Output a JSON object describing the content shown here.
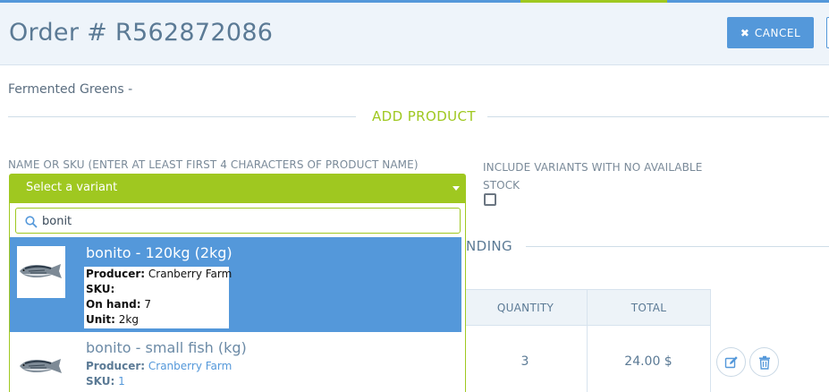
{
  "header": {
    "title": "Order # R562872086",
    "cancel_label": "CANCEL"
  },
  "subtitle": "Fermented Greens -",
  "add_product": {
    "section_title": "ADD PRODUCT",
    "name_label": "NAME OR SKU (ENTER AT LEAST FIRST 4 CHARACTERS OF PRODUCT NAME)",
    "select_placeholder": "Select a variant",
    "search_value": "bonit",
    "include_variants_label": "INCLUDE VARIANTS WITH NO AVAILABLE STOCK",
    "include_variants_checked": false
  },
  "results": [
    {
      "title": "bonito - 120kg (2kg)",
      "producer_label": "Producer:",
      "producer": "Cranberry Farm",
      "sku_label": "SKU:",
      "sku": "",
      "on_hand_label": "On hand:",
      "on_hand": "7",
      "unit_label": "Unit:",
      "unit": "2kg",
      "icon": "fish-thumbnail"
    },
    {
      "title": "bonito - small fish (kg)",
      "producer_label": "Producer:",
      "producer": "Cranberry Farm",
      "sku_label": "SKU:",
      "sku": "1",
      "icon": "fish-thumbnail"
    }
  ],
  "pending": {
    "section_title_visible": "NDING"
  },
  "table": {
    "headers": [
      "QUANTITY",
      "TOTAL"
    ],
    "rows": [
      {
        "quantity": "3",
        "total": "24.00 $"
      }
    ]
  },
  "colors": {
    "accent_green": "#9fc820",
    "accent_blue": "#5498da",
    "header_bg": "#eef4fa",
    "title_text": "#5b7a95"
  }
}
